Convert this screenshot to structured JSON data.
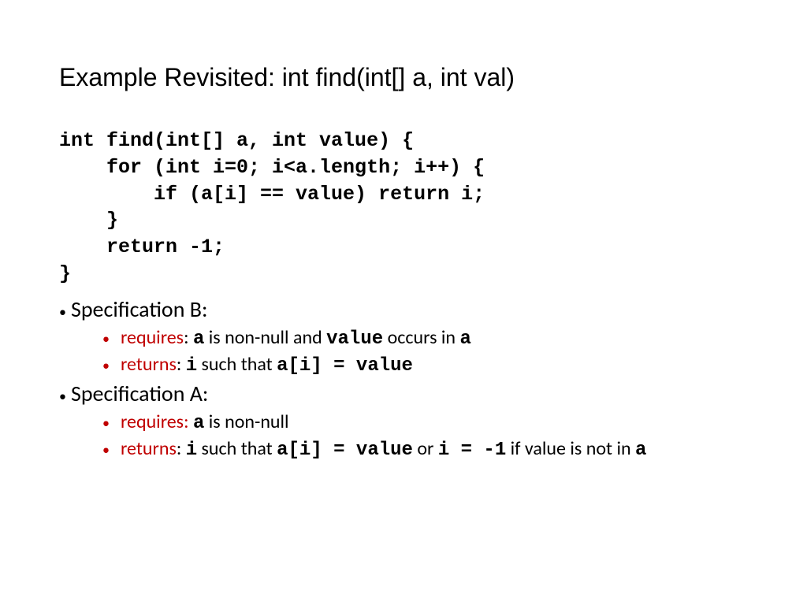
{
  "title": "Example Revisited: int find(int[] a, int val)",
  "code": {
    "l1": "int find(int[] a, int value) {",
    "l2": "    for (int i=0; i<a.length; i++) {",
    "l3": "        if (a[i] == value) return i;",
    "l4": "    }",
    "l5": "    return -1;",
    "l6": "}"
  },
  "specB": {
    "heading": "Specification B:",
    "req": {
      "kw": "requires",
      "colon": ": ",
      "m1": "a",
      "t1": " is non-null and ",
      "m2": "value",
      "t2": " occurs in ",
      "m3": "a"
    },
    "ret": {
      "kw": "returns",
      "colon": ": ",
      "m1": "i",
      "t1": " such that ",
      "m2": "a[i] = value"
    }
  },
  "specA": {
    "heading": "Specification A:",
    "req": {
      "kw": "requires:",
      "sp": " ",
      "m1": "a",
      "t1": " is non-null"
    },
    "ret": {
      "kw": "returns",
      "colon": ": ",
      "m1": "i",
      "t1": " such that ",
      "m2": "a[i] = value",
      "t2": " or ",
      "m3": "i = -1",
      "t3": " if value is not in ",
      "m4": "a"
    }
  }
}
